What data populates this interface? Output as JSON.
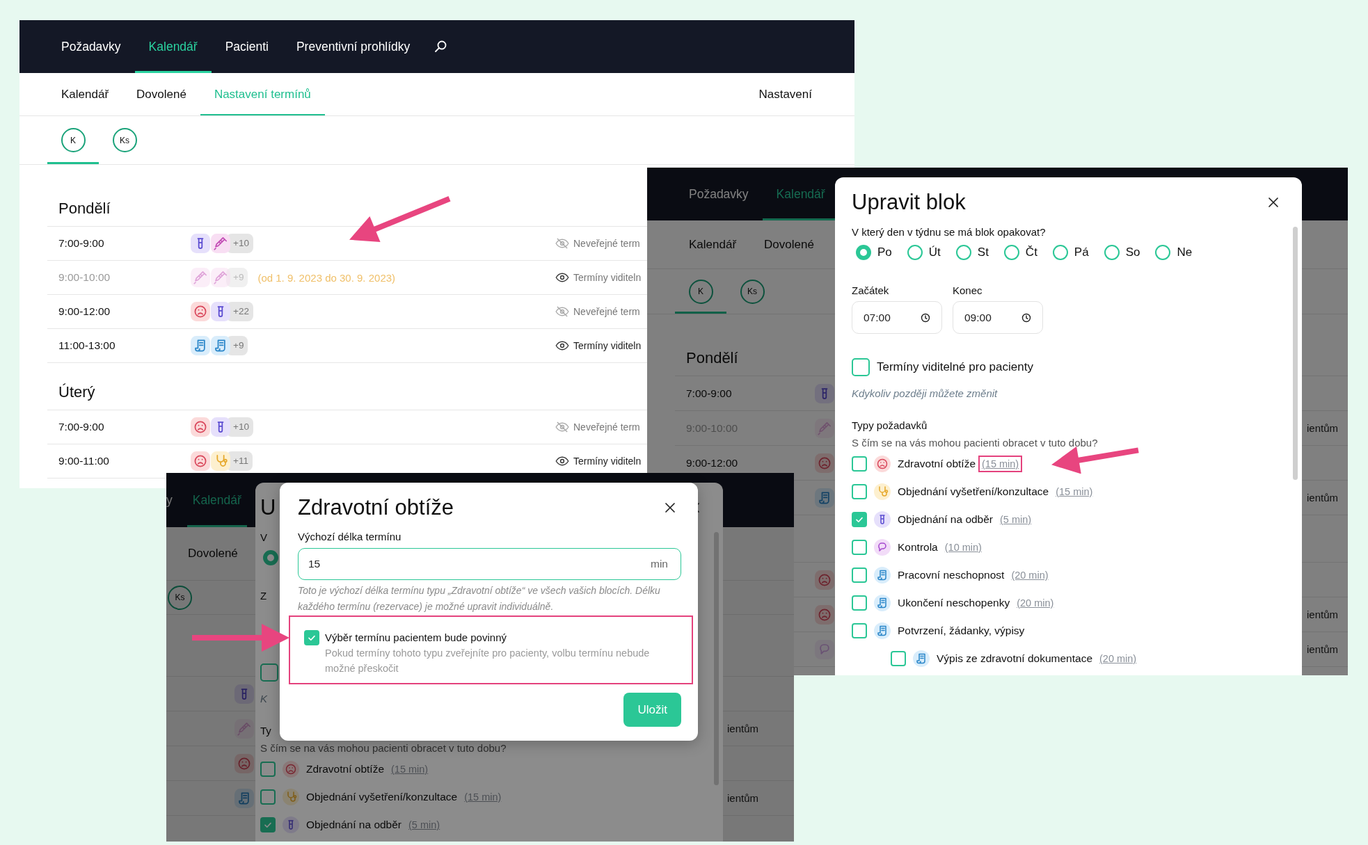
{
  "back_window": {
    "nav": [
      {
        "label": "Požadavky",
        "selected": false
      },
      {
        "label": "Kalendář",
        "selected": true
      },
      {
        "label": "Pacienti",
        "selected": false
      },
      {
        "label": "Preventivní prohlídky",
        "selected": false
      }
    ],
    "tabs": [
      {
        "label": "Kalendář",
        "selected": false
      },
      {
        "label": "Dovolené",
        "selected": false
      },
      {
        "label": "Nastavení termínů",
        "selected": true
      }
    ],
    "settings_link": "Nastavení",
    "avatars": [
      {
        "initials": "K",
        "selected": true
      },
      {
        "initials": "Ks",
        "selected": false
      }
    ],
    "days": [
      {
        "name": "Pondělí",
        "rows": [
          {
            "time": "7:00-9:00",
            "faded": false,
            "icons": [
              {
                "kind": "tube"
              },
              {
                "kind": "syringe"
              }
            ],
            "more": "+10",
            "public": false,
            "visibility": "Neveřejné term"
          },
          {
            "time": "9:00-10:00",
            "faded": true,
            "icons": [
              {
                "kind": "syringe"
              },
              {
                "kind": "syringe"
              }
            ],
            "more": "+9",
            "period": "(od 1. 9. 2023 do 30. 9. 2023)",
            "public": true,
            "visibility": "Termíny viditeln"
          },
          {
            "time": "9:00-12:00",
            "faded": false,
            "icons": [
              {
                "kind": "sad"
              },
              {
                "kind": "tube"
              }
            ],
            "more": "+22",
            "public": false,
            "visibility": "Neveřejné term"
          },
          {
            "time": "11:00-13:00",
            "faded": false,
            "icons": [
              {
                "kind": "doc"
              },
              {
                "kind": "doc"
              }
            ],
            "more": "+9",
            "public": true,
            "visibility": "Termíny viditeln"
          }
        ]
      },
      {
        "name": "Úterý",
        "rows": [
          {
            "time": "7:00-9:00",
            "faded": false,
            "icons": [
              {
                "kind": "sad"
              },
              {
                "kind": "tube"
              }
            ],
            "more": "+10",
            "public": false,
            "visibility": "Neveřejné term"
          },
          {
            "time": "9:00-11:00",
            "faded": false,
            "icons": [
              {
                "kind": "sad"
              },
              {
                "kind": "stethoscope"
              }
            ],
            "more": "+11",
            "public": true,
            "visibility": "Termíny viditeln"
          }
        ]
      }
    ]
  },
  "right_window": {
    "nav": [
      {
        "label": "Požadavky",
        "selected": false
      },
      {
        "label": "Kalendář",
        "selected": true
      }
    ],
    "tabs": [
      {
        "label": "Kalendář",
        "selected": false
      },
      {
        "label": "Dovolené",
        "selected": false
      }
    ],
    "avatars": [
      {
        "initials": "K",
        "selected": true
      },
      {
        "initials": "Ks",
        "selected": false
      }
    ],
    "days": [
      {
        "name": "Pondělí",
        "rows": [
          {
            "time": "7:00-9:00",
            "faded": false,
            "icons": [
              {
                "kind": "tube"
              }
            ]
          },
          {
            "time": "9:00-10:00",
            "faded": true,
            "icons": [
              {
                "kind": "syringe"
              }
            ],
            "tail": "ientům"
          },
          {
            "time": "9:00-12:00",
            "faded": false,
            "icons": [
              {
                "kind": "sad"
              }
            ]
          },
          {
            "faded": false,
            "icons": [
              {
                "kind": "doc"
              }
            ],
            "tail": "ientům"
          }
        ]
      },
      {
        "rows": [
          {
            "faded": false,
            "icons": [
              {
                "kind": "sad"
              }
            ]
          },
          {
            "faded": false,
            "icons": [
              {
                "kind": "sad"
              }
            ],
            "tail": "ientům"
          },
          {
            "faded": true,
            "icons": [
              {
                "kind": "chat"
              }
            ],
            "tail": "ientům"
          }
        ]
      }
    ],
    "dialog": {
      "title": "Upravit blok",
      "question": "V který den v týdnu se má blok opakovat?",
      "weekdays": [
        {
          "label": "Po",
          "selected": true
        },
        {
          "label": "Út",
          "selected": false
        },
        {
          "label": "St",
          "selected": false
        },
        {
          "label": "Čt",
          "selected": false
        },
        {
          "label": "Pá",
          "selected": false
        },
        {
          "label": "So",
          "selected": false
        },
        {
          "label": "Ne",
          "selected": false
        }
      ],
      "times": [
        {
          "label": "Začátek",
          "value": "07:00"
        },
        {
          "label": "Konec",
          "value": "09:00"
        }
      ],
      "visible_checkbox": {
        "label": "Termíny viditelné pro pacienty",
        "checked": false
      },
      "hint": "Kdykoliv později můžete změnit",
      "section": "Typy požadavků",
      "subtitle": "S čím se na vás mohou pacienti obracet v tuto dobu?",
      "types": [
        {
          "label": "Zdravotní obtíže",
          "duration": "(15 min)",
          "kind": "sad",
          "checked": false,
          "highlighted": true
        },
        {
          "label": "Objednání vyšetření/konzultace",
          "duration": "(15 min)",
          "kind": "stethoscope",
          "checked": false,
          "highlighted": false
        },
        {
          "label": "Objednání na odběr",
          "duration": "(5 min)",
          "kind": "tube",
          "checked": true,
          "highlighted": false
        },
        {
          "label": "Kontrola",
          "duration": "(10 min)",
          "kind": "chat",
          "checked": false,
          "highlighted": false
        },
        {
          "label": "Pracovní neschopnost",
          "duration": "(20 min)",
          "kind": "doc",
          "checked": false,
          "highlighted": false
        },
        {
          "label": "Ukončení neschopenky",
          "duration": "(20 min)",
          "kind": "doc",
          "checked": false,
          "highlighted": false
        },
        {
          "label": "Potvrzení, žádanky, výpisy",
          "kind": "doc",
          "checked": false,
          "children": [
            {
              "label": "Výpis ze zdravotní dokumentace",
              "duration": "(20 min)",
              "kind": "doc",
              "checked": false,
              "highlighted": false
            }
          ]
        }
      ]
    }
  },
  "bottom_window": {
    "nav": [
      {
        "label": "y",
        "selected": false
      },
      {
        "label": "Kalendář",
        "selected": true
      }
    ],
    "tabs": [
      {
        "label": "Dovolené",
        "selected": false
      }
    ],
    "avatars": [
      {
        "initials": "Ks",
        "selected": false
      }
    ],
    "days": [
      {
        "rows": [
          {
            "faded": false,
            "icons": [
              {
                "kind": "tube"
              }
            ]
          },
          {
            "faded": true,
            "icons": [
              {
                "kind": "syringe"
              }
            ],
            "tail": "ientům"
          },
          {
            "faded": false,
            "icons": [
              {
                "kind": "sad"
              }
            ]
          },
          {
            "faded": false,
            "icons": [
              {
                "kind": "doc"
              }
            ],
            "tail": "ientům"
          }
        ]
      }
    ],
    "dialog_behind": {
      "title": "U",
      "question": "V",
      "weekdays": [
        {
          "selected": true
        }
      ],
      "times": [
        {
          "label": "Z"
        }
      ],
      "visible_checkbox": {
        "checked": false
      },
      "hint": "K",
      "section": "Ty",
      "subtitle": "S čím se na vás mohou pacienti obracet v tuto dobu?",
      "types": [
        {
          "label": "Zdravotní obtíže",
          "duration": "(15 min)",
          "kind": "sad",
          "checked": false,
          "highlighted": false
        },
        {
          "label": "Objednání vyšetření/konzultace",
          "duration": "(15 min)",
          "kind": "stethoscope",
          "checked": false,
          "highlighted": false
        },
        {
          "label": "Objednání na odběr",
          "duration": "(5 min)",
          "kind": "tube",
          "checked": true,
          "highlighted": false
        }
      ]
    },
    "dialog": {
      "title": "Zdravotní obtíže",
      "field_label": "Výchozí délka termínu",
      "value": "15",
      "unit": "min",
      "help": "Toto je výchozí délka termínu typu „Zdravotní obtíže“ ve všech vašich blocích. Délku každého termínu (rezervace) je možné upravit individuálně.",
      "required": {
        "label": "Výběr termínu pacientem bude povinný",
        "description": "Pokud termíny tohoto typu zveřejníte pro pacienty, volbu termínu nebude možné přeskočit",
        "checked": true,
        "highlighted": true
      },
      "button": "Uložit"
    }
  }
}
